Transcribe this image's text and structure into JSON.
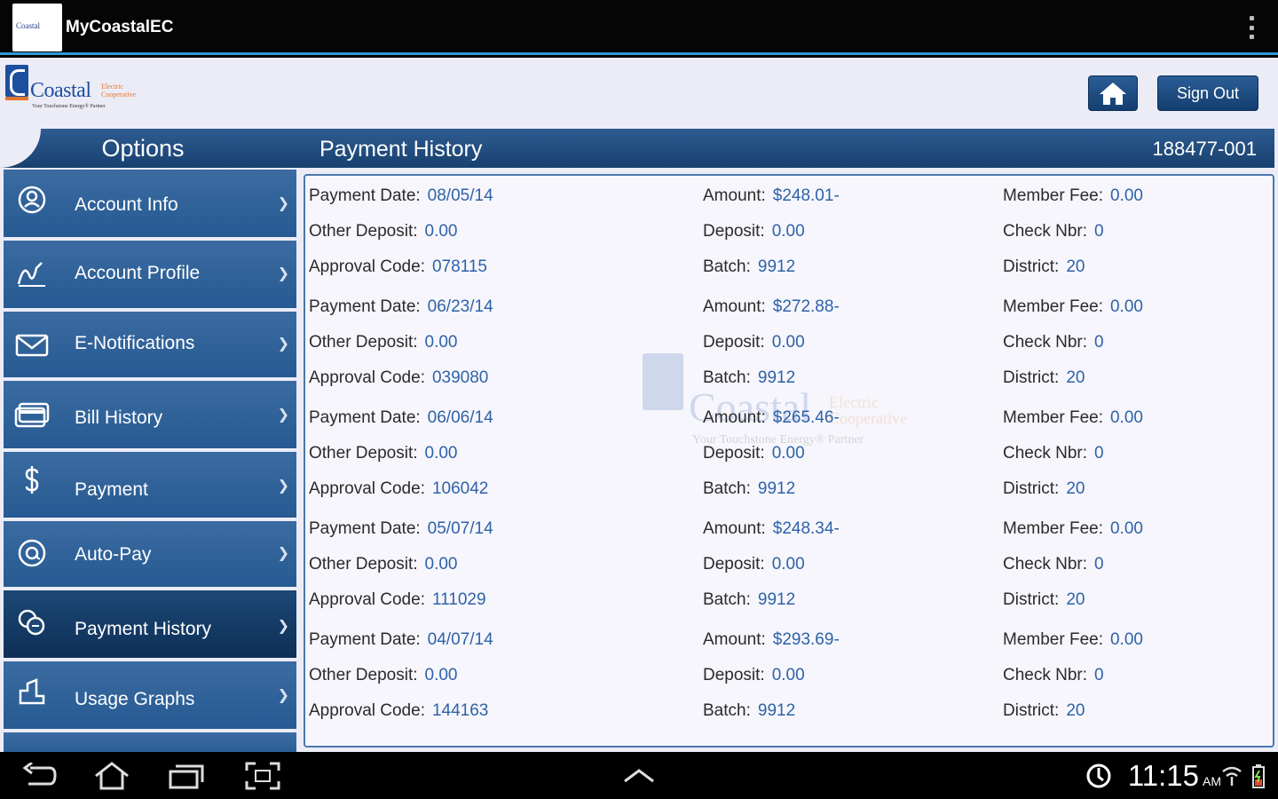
{
  "appbar": {
    "title": "MyCoastalEC",
    "icon_text": "Coastal"
  },
  "header": {
    "logo_text": "Coastal",
    "logo_small": "Electric Cooperative",
    "logo_tagline": "Your Touchstone Energy® Partner",
    "signout_label": "Sign Out"
  },
  "sidebar": {
    "title": "Options",
    "items": [
      {
        "label": "Account Info",
        "icon": "person-circle-icon"
      },
      {
        "label": "Account Profile",
        "icon": "signature-icon"
      },
      {
        "label": "E-Notifications",
        "icon": "envelope-icon"
      },
      {
        "label": "Bill History",
        "icon": "card-icon"
      },
      {
        "label": "Payment",
        "icon": "dollar-icon"
      },
      {
        "label": "Auto-Pay",
        "icon": "at-circle-icon"
      },
      {
        "label": "Payment History",
        "icon": "coins-icon",
        "active": true
      },
      {
        "label": "Usage Graphs",
        "icon": "graph-icon"
      }
    ]
  },
  "main": {
    "title": "Payment History",
    "account_number": "188477-001",
    "labels": {
      "payment_date": "Payment Date:",
      "other_deposit": "Other Deposit:",
      "approval_code": "Approval Code:",
      "amount": "Amount:",
      "deposit": "Deposit:",
      "batch": "Batch:",
      "member_fee": "Member Fee:",
      "check_nbr": "Check Nbr:",
      "district": "District:"
    },
    "watermark": {
      "text": "Coastal",
      "small": "Electric Cooperative",
      "tagline": "Your Touchstone Energy® Partner"
    },
    "records": [
      {
        "payment_date": "08/05/14",
        "other_deposit": "0.00",
        "approval_code": "078115",
        "amount": "$248.01-",
        "deposit": "0.00",
        "batch": "9912",
        "member_fee": "0.00",
        "check_nbr": "0",
        "district": "20"
      },
      {
        "payment_date": "06/23/14",
        "other_deposit": "0.00",
        "approval_code": "039080",
        "amount": "$272.88-",
        "deposit": "0.00",
        "batch": "9912",
        "member_fee": "0.00",
        "check_nbr": "0",
        "district": "20"
      },
      {
        "payment_date": "06/06/14",
        "other_deposit": "0.00",
        "approval_code": "106042",
        "amount": "$265.46-",
        "deposit": "0.00",
        "batch": "9912",
        "member_fee": "0.00",
        "check_nbr": "0",
        "district": "20"
      },
      {
        "payment_date": "05/07/14",
        "other_deposit": "0.00",
        "approval_code": "111029",
        "amount": "$248.34-",
        "deposit": "0.00",
        "batch": "9912",
        "member_fee": "0.00",
        "check_nbr": "0",
        "district": "20"
      },
      {
        "payment_date": "04/07/14",
        "other_deposit": "0.00",
        "approval_code": "144163",
        "amount": "$293.69-",
        "deposit": "0.00",
        "batch": "9912",
        "member_fee": "0.00",
        "check_nbr": "0",
        "district": "20"
      }
    ]
  },
  "statusbar": {
    "time": "11:15",
    "ampm": "AM"
  },
  "colors": {
    "accent": "#2c9bd6",
    "header_blue": "#18416f",
    "value_blue": "#2f62a8",
    "logo_orange": "#e3762e"
  }
}
